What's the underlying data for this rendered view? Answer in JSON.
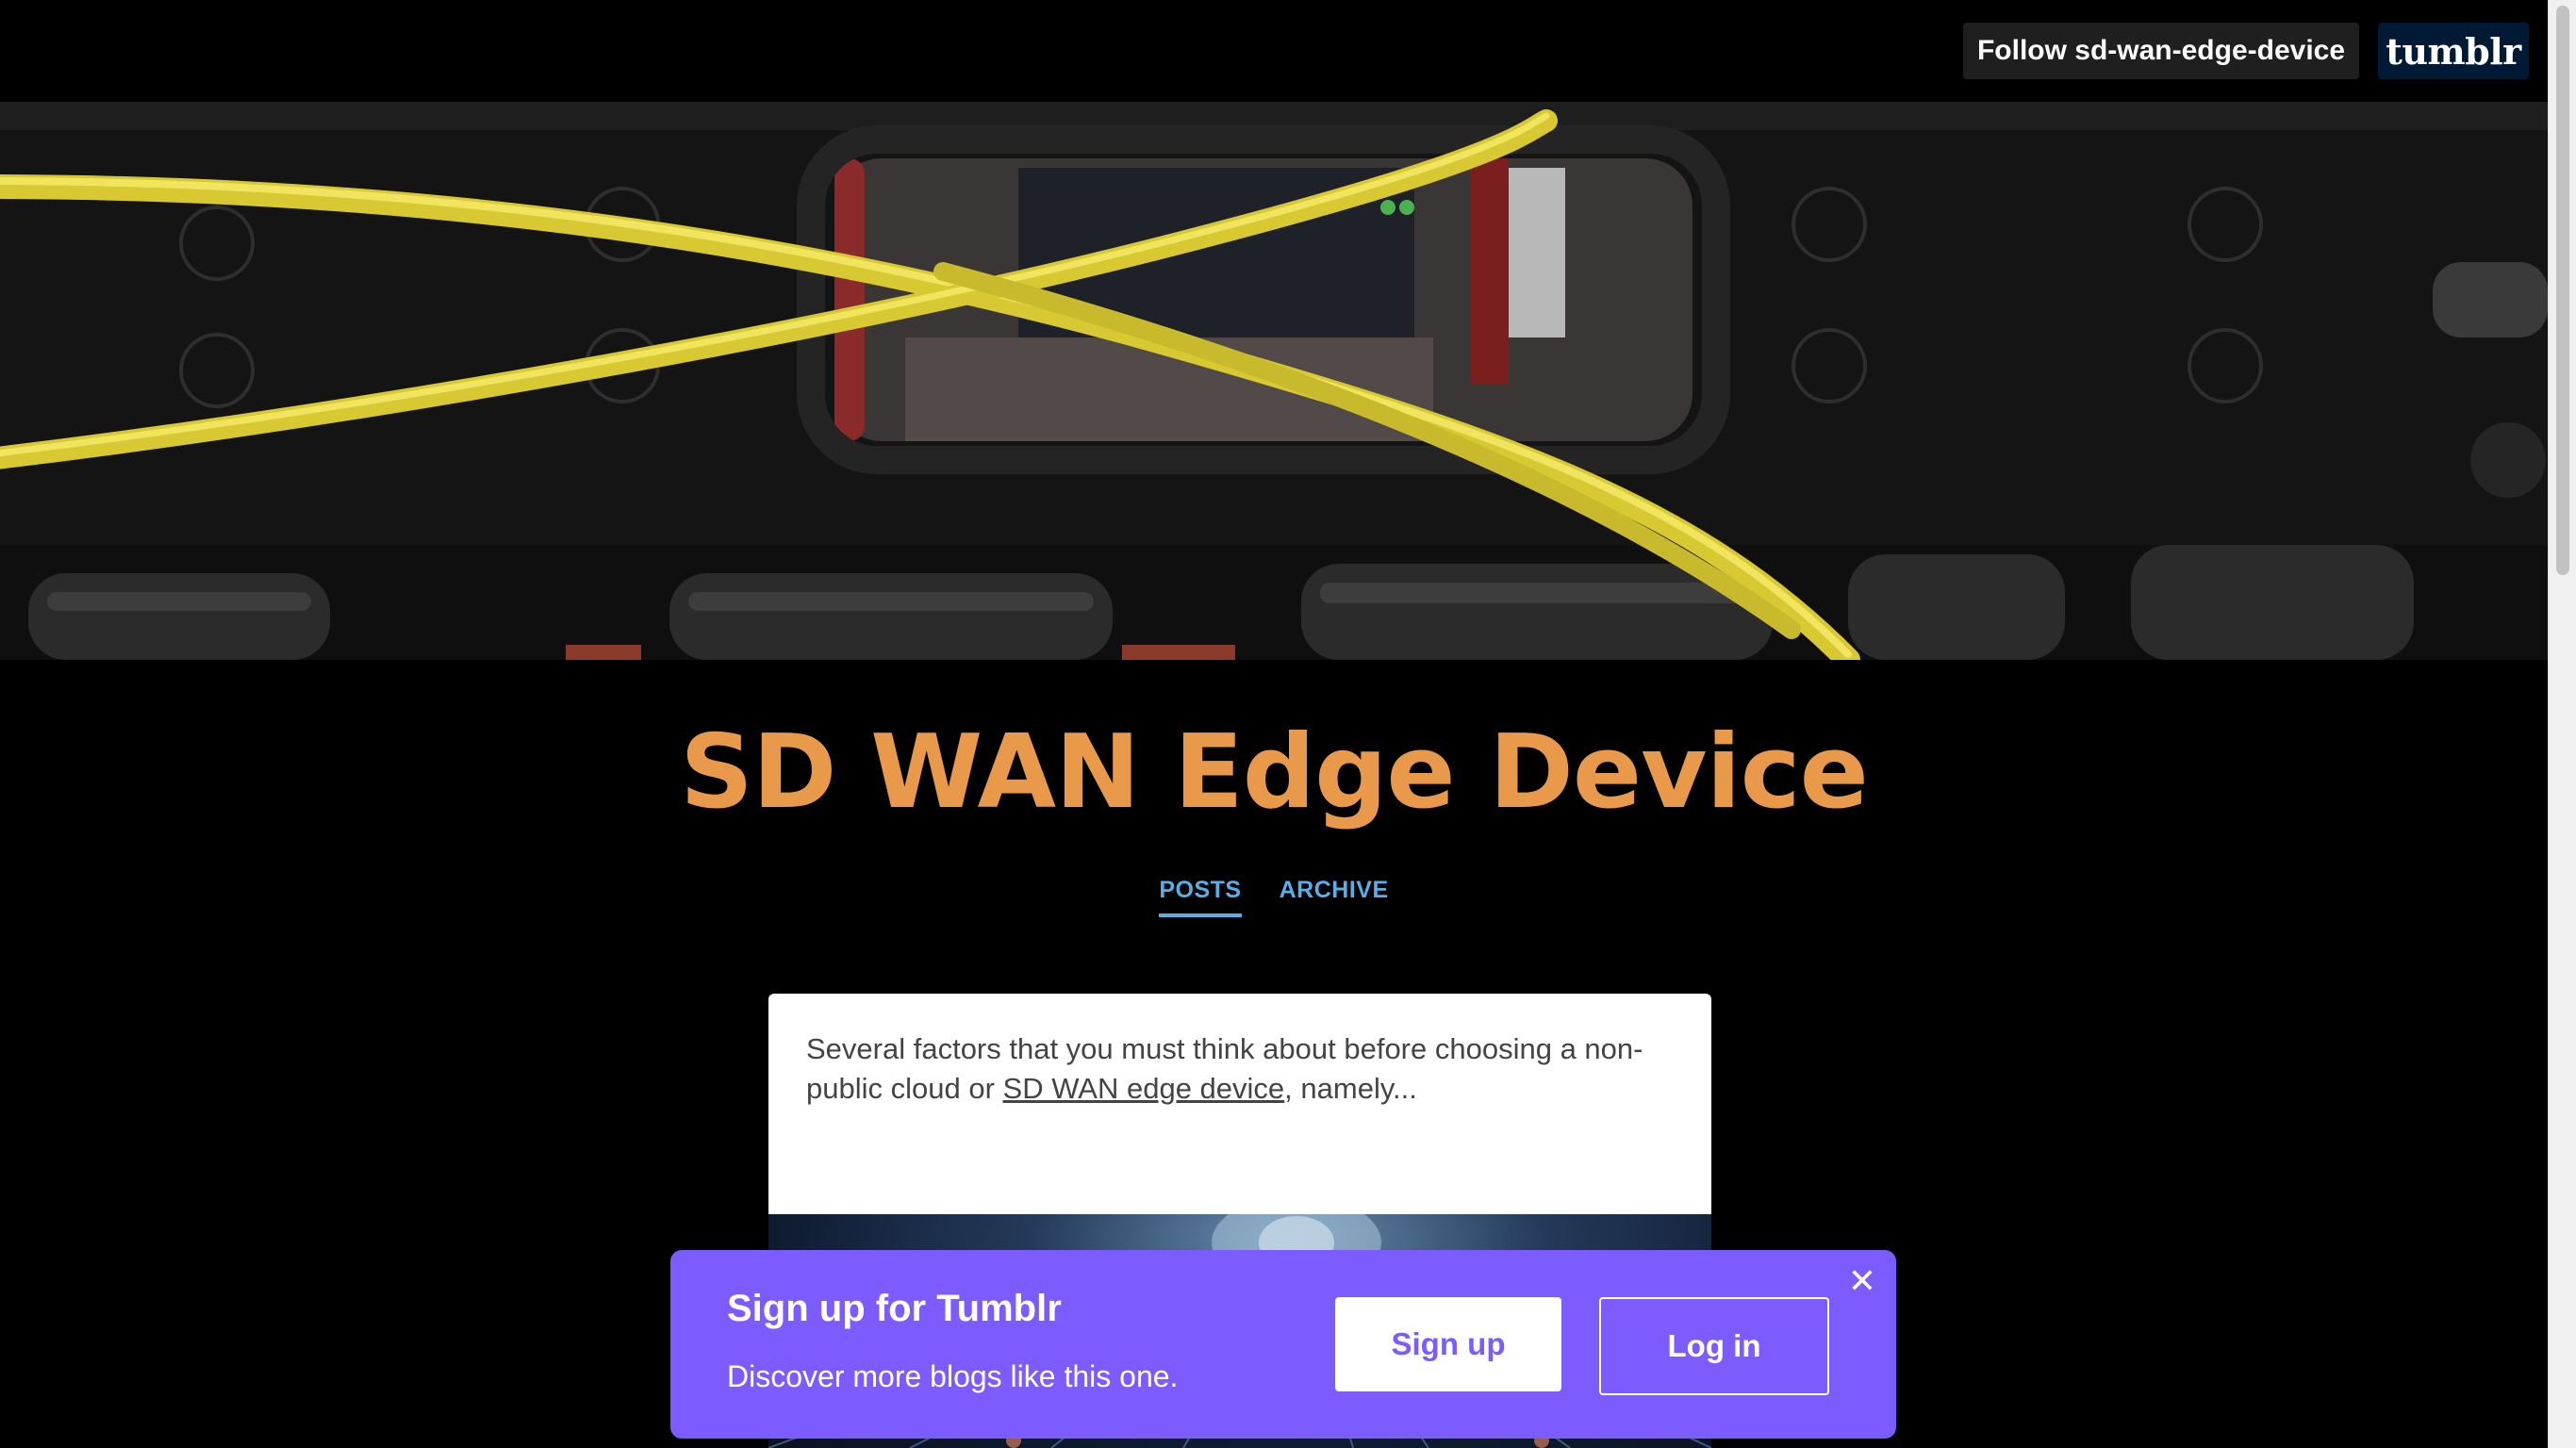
{
  "topbar": {
    "follow_label": "Follow sd-wan-edge-device",
    "logo_text": "tumblr"
  },
  "header_image": {
    "description_icon": "network-rack-photo"
  },
  "blog": {
    "title": "SD WAN Edge Device",
    "title_color": "#e8994a"
  },
  "nav": {
    "posts_label": "POSTS",
    "archive_label": "ARCHIVE",
    "active": "POSTS",
    "link_color": "#5aaee8"
  },
  "post": {
    "text_before": "Several factors that you must think about before choosing a non-public cloud or ",
    "link_text": "SD WAN edge device",
    "text_after": ", namely..."
  },
  "signup": {
    "title": "Sign up for Tumblr",
    "subtitle": "Discover more blogs like this one.",
    "signup_label": "Sign up",
    "login_label": "Log in",
    "close_icon": "close-icon",
    "accent": "#7c5cff"
  }
}
